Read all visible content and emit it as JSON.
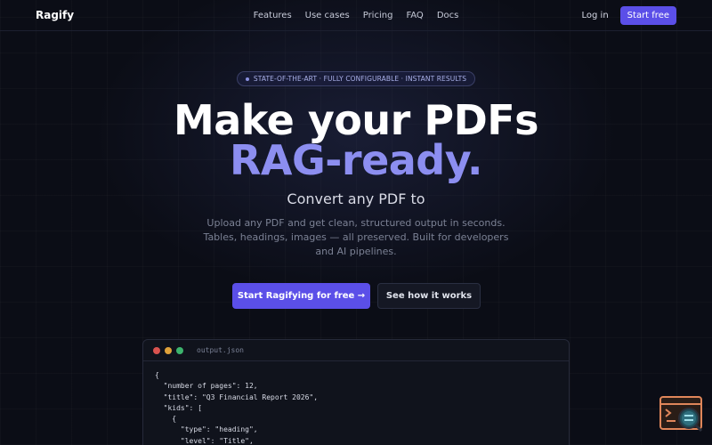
{
  "nav": {
    "brand": "Ragify",
    "links": [
      "Features",
      "Use cases",
      "Pricing",
      "FAQ",
      "Docs"
    ],
    "login": "Log in",
    "start": "Start free"
  },
  "hero": {
    "badge": "STATE-OF-THE-ART · FULLY CONFIGURABLE · INSTANT RESULTS",
    "title_line1": "Make your PDFs",
    "title_line2": "RAG-ready.",
    "subheading": "Convert any PDF to",
    "description": "Upload any PDF and get clean, structured output in seconds. Tables, headings, images — all preserved. Built for developers and AI pipelines.",
    "cta_primary": "Start Ragifying for free →",
    "cta_secondary": "See how it works"
  },
  "code": {
    "filename": "output.json",
    "lines": [
      "{",
      "  \"number of pages\": 12,",
      "  \"title\": \"Q3 Financial Report 2026\",",
      "  \"kids\": [",
      "    {",
      "      \"type\": \"heading\",",
      "      \"level\": \"Title\","
    ]
  },
  "colors": {
    "accent": "#5b4fe8",
    "title_accent": "#8c8ef0",
    "background": "#0b0d16"
  },
  "widget": {
    "icon": "terminal-search-icon"
  }
}
